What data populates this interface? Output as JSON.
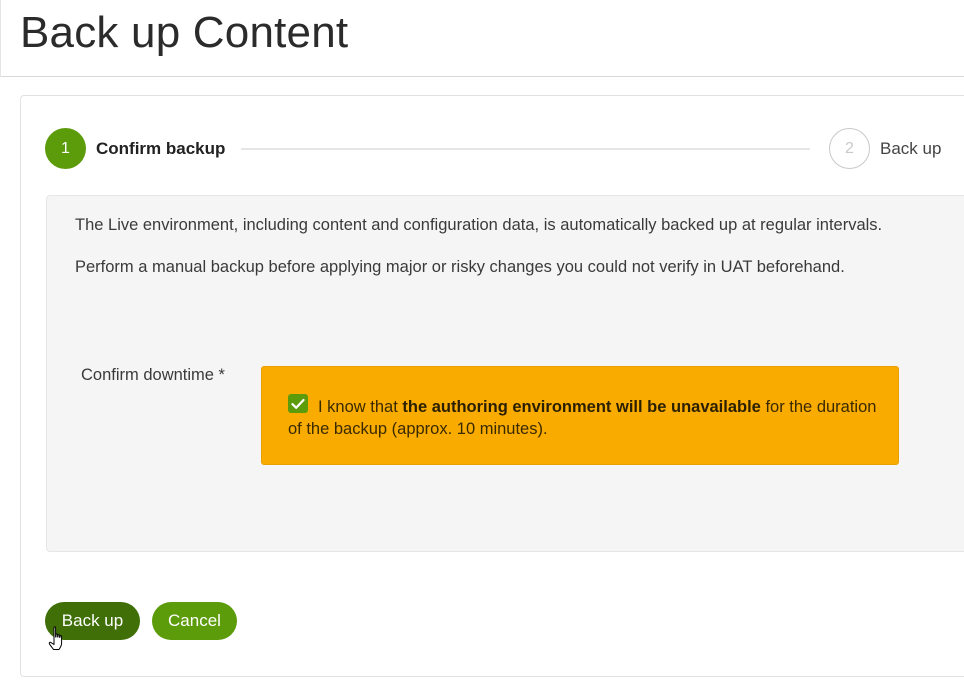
{
  "page": {
    "title": "Back up Content"
  },
  "stepper": {
    "steps": [
      {
        "number": "1",
        "label": "Confirm backup"
      },
      {
        "number": "2",
        "label": "Back up"
      }
    ]
  },
  "info": {
    "paragraph1": "The Live environment, including content and configuration data, is automatically backed up at regular intervals.",
    "paragraph2": "Perform a manual backup before applying major or risky changes you could not verify in UAT beforehand."
  },
  "confirm": {
    "label": "Confirm downtime *",
    "text_before": "I know that ",
    "text_bold": "the authoring environment will be unavailable",
    "text_after": " for the duration of the backup (approx. 10 minutes).",
    "checked": true
  },
  "actions": {
    "backup_label": "Back up",
    "cancel_label": "Cancel"
  },
  "colors": {
    "accent_green": "#5c9b0a",
    "dark_green": "#3f6f06",
    "warning_yellow": "#f9ab00",
    "panel_gray": "#f5f5f5"
  },
  "icons": {
    "checkbox": "checkmark-icon",
    "cursor": "hand-pointer-icon"
  }
}
